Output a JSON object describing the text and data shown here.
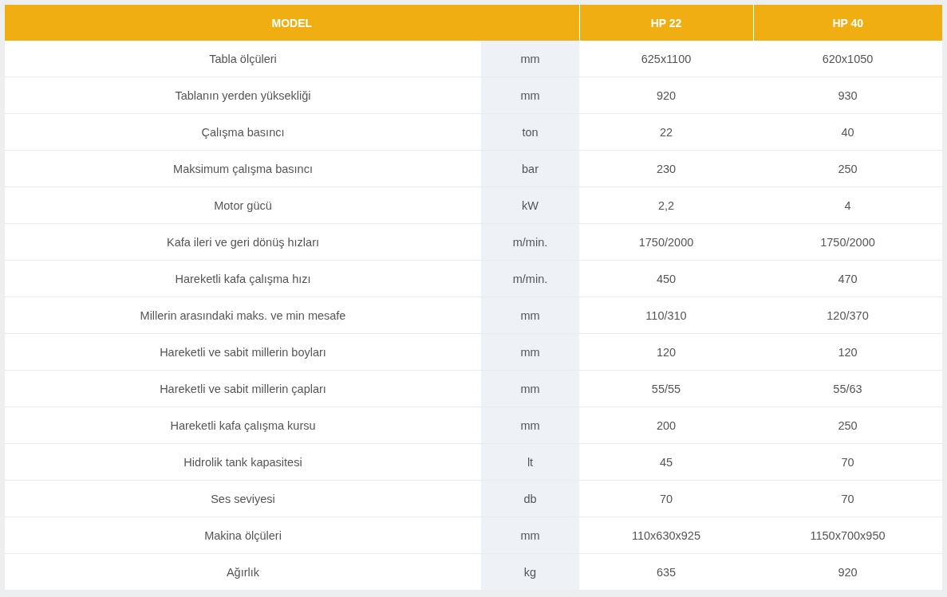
{
  "table": {
    "header": {
      "label": "MODEL",
      "models": [
        "HP 22",
        "HP 40"
      ]
    },
    "rows": [
      {
        "name": "Tabla ölçüleri",
        "unit": "mm",
        "values": [
          "625x1100",
          "620x1050"
        ]
      },
      {
        "name": "Tablanın yerden yüksekliği",
        "unit": "mm",
        "values": [
          "920",
          "930"
        ]
      },
      {
        "name": "Çalışma basıncı",
        "unit": "ton",
        "values": [
          "22",
          "40"
        ]
      },
      {
        "name": "Maksimum çalışma basıncı",
        "unit": "bar",
        "values": [
          "230",
          "250"
        ]
      },
      {
        "name": "Motor gücü",
        "unit": "kW",
        "values": [
          "2,2",
          "4"
        ]
      },
      {
        "name": "Kafa ileri ve geri dönüş hızları",
        "unit": "m/min.",
        "values": [
          "1750/2000",
          "1750/2000"
        ]
      },
      {
        "name": "Hareketli kafa çalışma hızı",
        "unit": "m/min.",
        "values": [
          "450",
          "470"
        ]
      },
      {
        "name": "Millerin arasındaki maks. ve min mesafe",
        "unit": "mm",
        "values": [
          "110/310",
          "120/370"
        ]
      },
      {
        "name": "Hareketli ve sabit millerin boyları",
        "unit": "mm",
        "values": [
          "120",
          "120"
        ]
      },
      {
        "name": "Hareketli ve sabit millerin çapları",
        "unit": "mm",
        "values": [
          "55/55",
          "55/63"
        ]
      },
      {
        "name": "Hareketli kafa çalışma kursu",
        "unit": "mm",
        "values": [
          "200",
          "250"
        ]
      },
      {
        "name": "Hidrolik tank kapasitesi",
        "unit": "lt",
        "values": [
          "45",
          "70"
        ]
      },
      {
        "name": "Ses seviyesi",
        "unit": "db",
        "values": [
          "70",
          "70"
        ]
      },
      {
        "name": "Makina ölçüleri",
        "unit": "mm",
        "values": [
          "110x630x925",
          "1150x700x950"
        ]
      },
      {
        "name": "Ağırlık",
        "unit": "kg",
        "values": [
          "635",
          "920"
        ]
      }
    ]
  }
}
